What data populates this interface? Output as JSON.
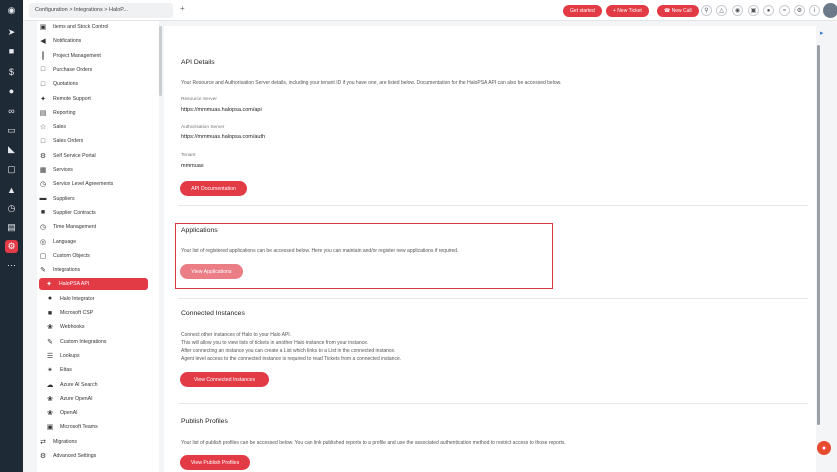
{
  "topbar": {
    "tab_label": "Configuration > Integrations > HaloP...",
    "add_tab": "+",
    "get_started": "Get started",
    "new_ticket": "+ New Ticket",
    "new_call": "☎ New Call",
    "icons": [
      "search-icon",
      "bell-icon",
      "notifications-icon",
      "lock-icon",
      "shield-icon",
      "wifi-icon",
      "gear-icon",
      "info-icon"
    ]
  },
  "rail_icons": [
    "logo-icon",
    "rocket-icon",
    "briefcase-icon",
    "dollar-icon",
    "person-icon",
    "link-icon",
    "monitor-icon",
    "chart-icon",
    "document-icon",
    "users-icon",
    "clock-icon",
    "file-icon",
    "settings-icon",
    "more-icon"
  ],
  "nav": {
    "items": [
      {
        "label": "Items and Stock Control",
        "icon": "box"
      },
      {
        "label": "Notifications",
        "icon": "megaphone"
      },
      {
        "label": "Project Management",
        "icon": "kanban"
      },
      {
        "label": "Purchase Orders",
        "icon": "document"
      },
      {
        "label": "Quotations",
        "icon": "document"
      },
      {
        "label": "Remote Support",
        "icon": "remote"
      },
      {
        "label": "Reporting",
        "icon": "report"
      },
      {
        "label": "Sales",
        "icon": "sales"
      },
      {
        "label": "Sales Orders",
        "icon": "document"
      },
      {
        "label": "Self Service Portal",
        "icon": "portal"
      },
      {
        "label": "Services",
        "icon": "services"
      },
      {
        "label": "Service Level Agreements",
        "icon": "clock"
      },
      {
        "label": "Suppliers",
        "icon": "truck"
      },
      {
        "label": "Supplier Contracts",
        "icon": "contract"
      },
      {
        "label": "Time Management",
        "icon": "clock"
      },
      {
        "label": "Language",
        "icon": "globe"
      },
      {
        "label": "Custom Objects",
        "icon": "object"
      },
      {
        "label": "Integrations",
        "icon": "plug"
      }
    ],
    "sub_items": [
      {
        "label": "HaloPSA API",
        "icon": "api"
      },
      {
        "label": "Halo Integrator",
        "icon": "halo"
      },
      {
        "label": "Microsoft CSP",
        "icon": "microsoft"
      },
      {
        "label": "Webhooks",
        "icon": "webhook"
      },
      {
        "label": "Custom Integrations",
        "icon": "plug"
      },
      {
        "label": "Lookups",
        "icon": "lookup"
      },
      {
        "label": "Ettas",
        "icon": "ettas"
      },
      {
        "label": "Azure AI Search",
        "icon": "cloud"
      },
      {
        "label": "Azure OpenAI",
        "icon": "openai"
      },
      {
        "label": "OpenAI",
        "icon": "openai"
      },
      {
        "label": "Microsoft Teams",
        "icon": "teams"
      }
    ],
    "tail_items": [
      {
        "label": "Migrations",
        "icon": "migrate"
      },
      {
        "label": "Advanced Settings",
        "icon": "gear"
      }
    ]
  },
  "api_details": {
    "title": "API Details",
    "description": "Your Resource and Authorisation Server details, including your tenant ID if you have one, are listed below. Documentation for the HaloPSA API can also be accessed below.",
    "resource_label": "Resource Server",
    "resource_value": "https://mmmuas.halopsa.com/api",
    "auth_label": "Authorisation Server",
    "auth_value": "https://mmmuas.halopsa.com/auth",
    "tenant_label": "Tenant",
    "tenant_value": "mmmuas",
    "doc_button": "API Documentation"
  },
  "applications": {
    "title": "Applications",
    "description": "Your list of registered applications can be accessed below. Here you can maintain and/or register new applications if required.",
    "button": "View Applications"
  },
  "connected": {
    "title": "Connected Instances",
    "lines": [
      "Connect other instances of Halo to your Halo API.",
      "This will allow you to view lists of tickets in another Halo instance from your instance.",
      "After connecting an instance you can create a List which links to a List in the connected instance.",
      "Agent level access to the connected instance is required to read Tickets from a connected instance."
    ],
    "button": "View Connected Instances"
  },
  "publish": {
    "title": "Publish Profiles",
    "description": "Your list of publish profiles can be accessed below. You can link published reports to a profile and use the associated authentication method to restrict access to those reports.",
    "button": "View Publish Profiles"
  }
}
